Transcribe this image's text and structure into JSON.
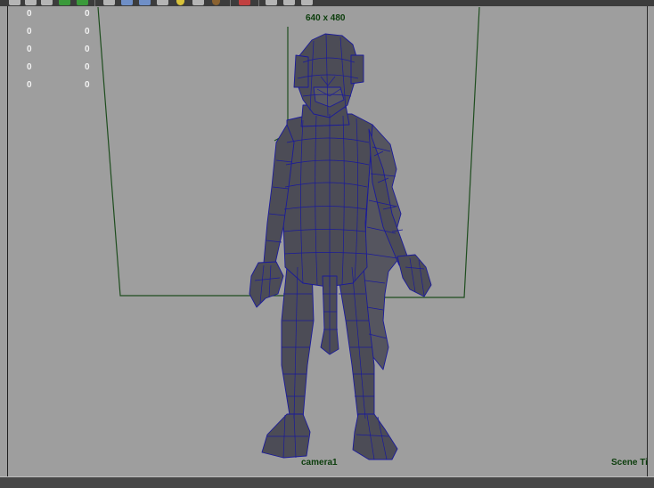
{
  "toolbar": {
    "icons": [
      "select-icon",
      "lasso-icon",
      "move-icon",
      "render-icon",
      "ipr-icon",
      "camera-icon",
      "wireframe-icon",
      "shaded-icon",
      "textured-icon",
      "light-icon",
      "bulb-icon",
      "shadow-icon",
      "isolate-icon",
      "xray-icon",
      "grid-icon",
      "snapshot-icon"
    ]
  },
  "hud": {
    "rows": [
      {
        "left": "0",
        "right": "0"
      },
      {
        "left": "0",
        "right": "0"
      },
      {
        "left": "0",
        "right": "0"
      },
      {
        "left": "0",
        "right": "0"
      },
      {
        "left": "0",
        "right": "0"
      }
    ]
  },
  "viewport": {
    "resolution_gate_label": "640 x 480",
    "camera_label": "camera1",
    "scene_label": "Scene Ti"
  },
  "colors": {
    "background": "#9e9e9e",
    "gate_line": "#1e4d1e",
    "wire": "#1a1a9a",
    "mesh_fill": "#4c4c56"
  }
}
